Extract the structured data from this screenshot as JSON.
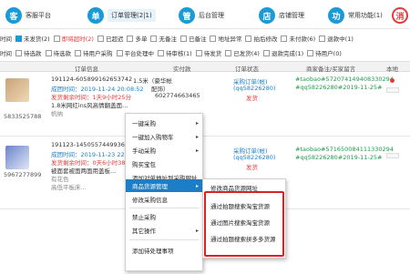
{
  "nav": [
    {
      "icon": "客",
      "label": "客服平台"
    },
    {
      "icon": "单",
      "label": "订单管理(2|1)"
    },
    {
      "icon": "管",
      "label": "后台管理"
    },
    {
      "icon": "店",
      "label": "店铺管理"
    },
    {
      "icon": "功",
      "label": "常用功能(1)"
    },
    {
      "icon": "消",
      "label": ""
    }
  ],
  "filters": {
    "row1_label": "时间",
    "row1": [
      "未发货(2)",
      "即将超时(2)",
      "已超迟",
      "多单",
      "无备注",
      "已备注",
      "地址异常",
      "拍后修改",
      "未付款(6)",
      "退款中(1)"
    ],
    "row2_label": "时间",
    "row2": [
      "待选款",
      "待选款",
      "待用户采购",
      "平台处理中",
      "待审核(1)",
      "待发货",
      "已发货(4)",
      "退款完成(1)",
      "待用户(0)"
    ]
  },
  "table_header": [
    "订单信息",
    "实付款",
    "订单状态",
    "商家备注/买家留言",
    "本地"
  ],
  "orders": [
    {
      "name": "客",
      "order_id": "5833525788",
      "line1": "191124-605899162653742",
      "time": "成团时间：2019-11-24 20:08:52",
      "remain": "发货剩余时间：1天9小时25分",
      "phone": "18",
      "title": "1.8米网红ins风高情翻盖面...",
      "extra": "帆纳",
      "spec": "1.5米（豪华帐",
      "spec2": "配饰）",
      "tracking": "602774663465",
      "status": "采购订单(帐)",
      "status2": "(qq58226280)",
      "ship": "发货",
      "note": "#taobao#572074149408330294",
      "note2": "#qq58226280#2019-11-25#"
    },
    {
      "order_id": "5967277899",
      "line1": "191123-145055744993608",
      "time": "成团时间：2019-11-23 22:06:35",
      "remain": "发货剩余时间：0天6小时38分",
      "phone": "1",
      "title": "被面套被面两面用盖板...",
      "extra": "有花色",
      "extra2": "高低平板床...",
      "status": "采购订单(帐)",
      "status2": "(qq58226280)",
      "ship": "发货",
      "note": "#taobao#571650084111330294",
      "note2": "#qq58226280#2019-11-25#"
    }
  ],
  "context_menu": {
    "items": [
      "一键采购",
      "一键加入购物车",
      "手动采购",
      "购买宝包",
      "添加对单地址到采购网址",
      "商品货源管理",
      "修改采购信息",
      "禁止采购",
      "其它操作",
      "添加待处理事项"
    ],
    "highlighted": "商品货源管理"
  },
  "submenu": {
    "items": [
      "修改商品货源网址",
      "通过拍题搜索淘宝货源",
      "通过图片搜索淘宝货源",
      "通过拍题搜索拼多多货源"
    ]
  },
  "colors": {
    "accent": "#1a9ad6",
    "highlight": "#1a7fc8",
    "warning": "#e23b3b",
    "annotation": "#e01f1f"
  }
}
